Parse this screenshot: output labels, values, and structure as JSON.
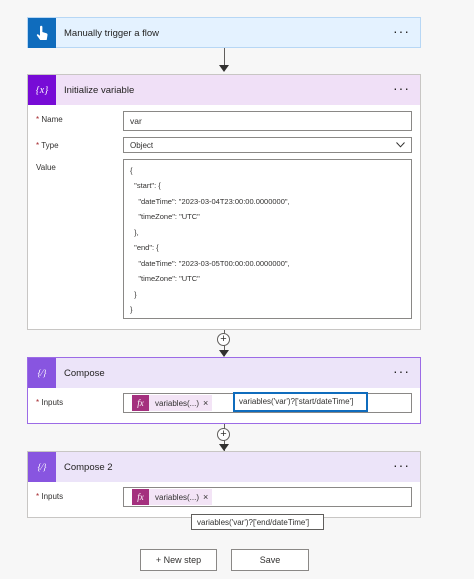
{
  "trigger": {
    "title": "Manually trigger a flow",
    "menu": "···",
    "color": "#0f6cbd"
  },
  "init_variable": {
    "title": "Initialize variable",
    "menu": "···",
    "icon_text": "{x}",
    "color": "#770bd6",
    "name_label": "Name",
    "name_value": "var",
    "type_label": "Type",
    "type_value": "Object",
    "value_label": "Value",
    "value_lines": [
      "{",
      "  \"start\": {",
      "    \"dateTime\": \"2023-03-04T23:00:00.0000000\",",
      "    \"timeZone\": \"UTC\"",
      "  },",
      "  \"end\": {",
      "    \"dateTime\": \"2023-03-05T00:00:00.0000000\",",
      "    \"timeZone\": \"UTC\"",
      "  }",
      "}"
    ]
  },
  "compose1": {
    "title": "Compose",
    "menu": "···",
    "icon_text": "{⁄}",
    "inputs_label": "Inputs",
    "token_fx": "fx",
    "token_label": "variables(...)",
    "token_remove": "×",
    "expression": "variables('var')?['start/dateTime']"
  },
  "compose2": {
    "title": "Compose 2",
    "menu": "···",
    "icon_text": "{⁄}",
    "inputs_label": "Inputs",
    "token_fx": "fx",
    "token_label": "variables(...)",
    "token_remove": "×",
    "tooltip": "variables('var')?['end/dateTime']"
  },
  "connector_plus": "+",
  "required_mark": "*",
  "footer": {
    "new_step": "+ New step",
    "save": "Save"
  }
}
